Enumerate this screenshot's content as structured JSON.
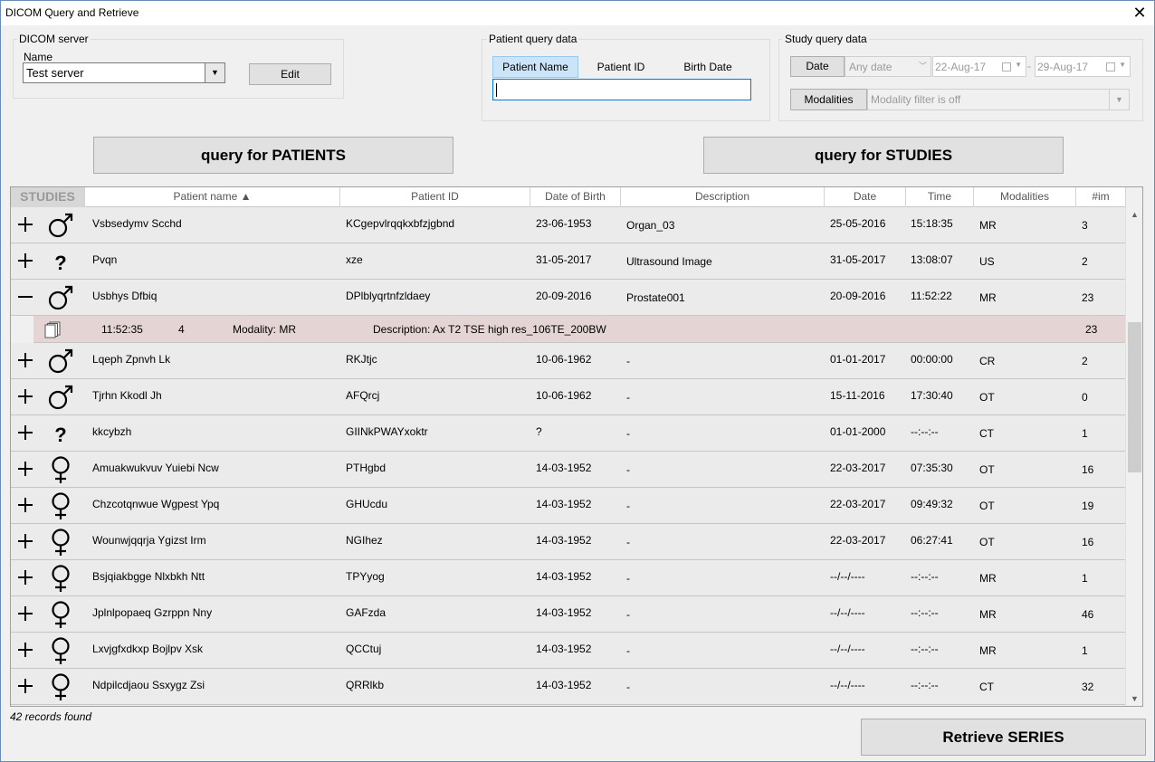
{
  "window": {
    "title": "DICOM Query and Retrieve",
    "close_icon": "close-icon"
  },
  "server": {
    "group_label": "DICOM server",
    "name_label": "Name",
    "selected": "Test server",
    "edit_label": "Edit"
  },
  "patient_query": {
    "group_label": "Patient query data",
    "tabs": [
      "Patient Name",
      "Patient ID",
      "Birth Date"
    ],
    "active_tab": "Patient Name",
    "input_value": ""
  },
  "study_query": {
    "group_label": "Study query data",
    "date_button": "Date",
    "date_range_option": "Any date",
    "date_from": "22-Aug-17",
    "date_sep": "-",
    "date_to": "29-Aug-17",
    "modalities_button": "Modalities",
    "modality_filter": "Modality filter is off"
  },
  "actions": {
    "query_patients": "query for PATIENTS",
    "query_studies": "query for STUDIES",
    "retrieve_series": "Retrieve SERIES"
  },
  "table": {
    "headers": {
      "studies": "STUDIES",
      "patient_name": "Patient name ▲",
      "patient_id": "Patient ID",
      "dob": "Date of Birth",
      "description": "Description",
      "date": "Date",
      "time": "Time",
      "modalities": "Modalities",
      "images": "#im"
    },
    "rows": [
      {
        "expander": "+",
        "sex": "male",
        "name": "Vsbsedymv Scchd",
        "id": "KCgepvlrqqkxbfzjgbnd",
        "dob": "23-06-1953",
        "description": "Organ_03",
        "date": "25-05-2016",
        "time": "15:18:35",
        "modality": "MR",
        "images": "3"
      },
      {
        "expander": "+",
        "sex": "unknown",
        "name": "Pvqn",
        "id": "xze",
        "dob": "31-05-2017",
        "description": "Ultrasound Image",
        "date": "31-05-2017",
        "time": "13:08:07",
        "modality": "US",
        "images": "2"
      },
      {
        "expander": "–",
        "sex": "male",
        "name": "Usbhys Dfbiq",
        "id": "DPlblyqrtnfzldaey",
        "dob": "20-09-2016",
        "description": "Prostate001",
        "date": "20-09-2016",
        "time": "11:52:22",
        "modality": "MR",
        "images": "23"
      },
      {
        "expander": "+",
        "sex": "male",
        "name": "Lqeph Zpnvh Lk",
        "id": "RKJtjc",
        "dob": "10-06-1962",
        "description": "-",
        "date": "01-01-2017",
        "time": "00:00:00",
        "modality": "CR",
        "images": "2"
      },
      {
        "expander": "+",
        "sex": "male",
        "name": "Tjrhn Kkodl Jh",
        "id": "AFQrcj",
        "dob": "10-06-1962",
        "description": "-",
        "date": "15-11-2016",
        "time": "17:30:40",
        "modality": "OT",
        "images": "0"
      },
      {
        "expander": "+",
        "sex": "unknown",
        "name": "kkcybzh",
        "id": "GIINkPWAYxoktr",
        "dob": "?",
        "description": "-",
        "date": "01-01-2000",
        "time": "--:--:--",
        "modality": "CT",
        "images": "1"
      },
      {
        "expander": "+",
        "sex": "female",
        "name": "Amuakwukvuv Yuiebi Ncw",
        "id": "PTHgbd",
        "dob": "14-03-1952",
        "description": "-",
        "date": "22-03-2017",
        "time": "07:35:30",
        "modality": "OT",
        "images": "16"
      },
      {
        "expander": "+",
        "sex": "female",
        "name": "Chzcotqnwue Wgpest Ypq",
        "id": "GHUcdu",
        "dob": "14-03-1952",
        "description": "-",
        "date": "22-03-2017",
        "time": "09:49:32",
        "modality": "OT",
        "images": "19"
      },
      {
        "expander": "+",
        "sex": "female",
        "name": "Wounwjqqrja Ygizst Irm",
        "id": "NGIhez",
        "dob": "14-03-1952",
        "description": "-",
        "date": "22-03-2017",
        "time": "06:27:41",
        "modality": "OT",
        "images": "16"
      },
      {
        "expander": "+",
        "sex": "female",
        "name": "Bsjqiakbgge Nlxbkh Ntt",
        "id": "TPYyog",
        "dob": "14-03-1952",
        "description": "-",
        "date": "--/--/----",
        "time": "--:--:--",
        "modality": "MR",
        "images": "1"
      },
      {
        "expander": "+",
        "sex": "female",
        "name": "Jplnlpopaeq Gzrppn Nny",
        "id": "GAFzda",
        "dob": "14-03-1952",
        "description": "-",
        "date": "--/--/----",
        "time": "--:--:--",
        "modality": "MR",
        "images": "46"
      },
      {
        "expander": "+",
        "sex": "female",
        "name": "Lxvjgfxdkxp Bojlpv Xsk",
        "id": "QCCtuj",
        "dob": "14-03-1952",
        "description": "-",
        "date": "--/--/----",
        "time": "--:--:--",
        "modality": "MR",
        "images": "1"
      },
      {
        "expander": "+",
        "sex": "female",
        "name": "Ndpilcdjaou Ssxygz Zsi",
        "id": "QRRlkb",
        "dob": "14-03-1952",
        "description": "-",
        "date": "--/--/----",
        "time": "--:--:--",
        "modality": "CT",
        "images": "32"
      }
    ],
    "series": {
      "after_row": 2,
      "time": "11:52:35",
      "number": "4",
      "modality": "Modality: MR",
      "description": "Description: Ax T2 TSE high res_106TE_200BW",
      "images": "23"
    }
  },
  "status": "42 records found"
}
